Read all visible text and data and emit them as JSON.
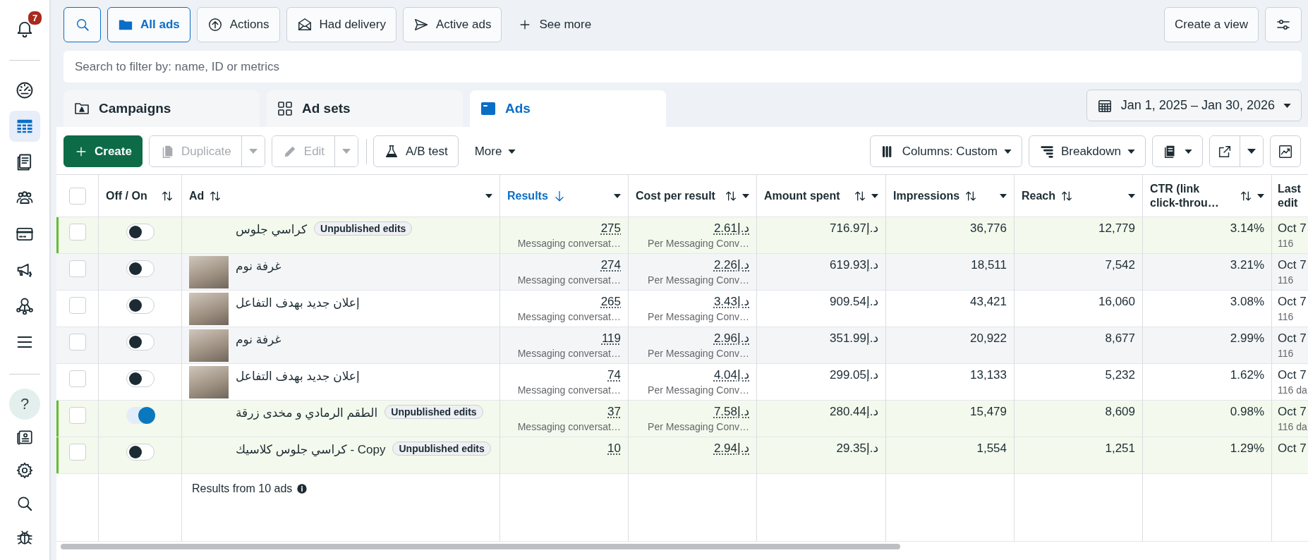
{
  "sidebar": {
    "notification_badge": "7",
    "items": [
      {
        "selected": false
      },
      {
        "selected": true
      },
      {
        "selected": false
      },
      {
        "selected": false
      },
      {
        "selected": false
      },
      {
        "selected": false
      },
      {
        "selected": false
      },
      {
        "selected": false
      }
    ],
    "help": {
      "label": "?"
    },
    "bottom_items": [
      {
        "selected": false
      },
      {
        "selected": false
      },
      {
        "selected": false
      },
      {
        "selected": false
      }
    ]
  },
  "filters": {
    "search_button": {
      "selected": true
    },
    "items": [
      {
        "label": "All ads",
        "selected": true
      },
      {
        "label": "Actions",
        "selected": false
      },
      {
        "label": "Had delivery",
        "selected": false
      },
      {
        "label": "Active ads",
        "selected": false
      }
    ],
    "see_more": "See more",
    "create_view": "Create a view"
  },
  "search": {
    "placeholder": "Search to filter by: name, ID or metrics"
  },
  "level_tabs": [
    {
      "label": "Campaigns",
      "selected": false
    },
    {
      "label": "Ad sets",
      "selected": false
    },
    {
      "label": "Ads",
      "selected": true
    }
  ],
  "date_range": "Jan 1, 2025 – Jan 30, 2026",
  "toolbar": {
    "create": "Create",
    "duplicate": {
      "label": "Duplicate",
      "disabled": true
    },
    "edit": {
      "label": "Edit",
      "disabled": true
    },
    "ab_test": "A/B test",
    "more": "More",
    "columns": "Columns: Custom",
    "breakdown": "Breakdown"
  },
  "table": {
    "select_all_checked": false,
    "columns": [
      {
        "label": "Off / On",
        "sorted": false
      },
      {
        "label": "Ad",
        "sorted": false
      },
      {
        "label": "Results",
        "sorted": true
      },
      {
        "label": "Cost per result",
        "sorted": false
      },
      {
        "label": "Amount spent",
        "sorted": false
      },
      {
        "label": "Impressions",
        "sorted": false
      },
      {
        "label": "Reach",
        "sorted": false
      },
      {
        "label": "CTR (link click-throu…",
        "sorted": false
      },
      {
        "label": "Last edit",
        "sorted": false
      }
    ],
    "rows": [
      {
        "checked": false,
        "on": false,
        "image": false,
        "name": "كراسي جلوس",
        "badge": "Unpublished edits",
        "results": "275",
        "result_type": "Messaging conversat…",
        "cost": "2.61د.إ",
        "cost_type": "Per Messaging Conv…",
        "spent": "716.97د.إ",
        "impressions": "36,776",
        "reach": "12,779",
        "ctr": "3.14%",
        "last_edit": "Oct 7",
        "last_edit_ago": "116"
      },
      {
        "checked": false,
        "on": false,
        "image": true,
        "name": "غرفة نوم",
        "results": "274",
        "result_type": "Messaging conversat…",
        "cost": "2.26د.إ",
        "cost_type": "Per Messaging Conv…",
        "spent": "619.93د.إ",
        "impressions": "18,511",
        "reach": "7,542",
        "ctr": "3.21%",
        "last_edit": "Oct 7",
        "last_edit_ago": "116"
      },
      {
        "checked": false,
        "on": false,
        "image": true,
        "name": "إعلان جديد بهدف التفاعل",
        "results": "265",
        "result_type": "Messaging conversat…",
        "cost": "3.43د.إ",
        "cost_type": "Per Messaging Conv…",
        "spent": "909.54د.إ",
        "impressions": "43,421",
        "reach": "16,060",
        "ctr": "3.08%",
        "last_edit": "Oct 7",
        "last_edit_ago": "116"
      },
      {
        "checked": false,
        "on": false,
        "image": true,
        "name": "غرفة نوم",
        "results": "119",
        "result_type": "Messaging conversat…",
        "cost": "2.96د.إ",
        "cost_type": "Per Messaging Conv…",
        "spent": "351.99د.إ",
        "impressions": "20,922",
        "reach": "8,677",
        "ctr": "2.99%",
        "last_edit": "Oct 7",
        "last_edit_ago": "116"
      },
      {
        "checked": false,
        "on": false,
        "image": true,
        "name": "إعلان جديد بهدف التفاعل",
        "results": "74",
        "result_type": "Messaging conversat…",
        "cost": "4.04د.إ",
        "cost_type": "Per Messaging Conv…",
        "spent": "299.05د.إ",
        "impressions": "13,133",
        "reach": "5,232",
        "ctr": "1.62%",
        "last_edit": "Oct 7",
        "last_edit_ago": "116 da"
      },
      {
        "checked": false,
        "on": true,
        "image": false,
        "name": "الطقم الرمادي و مخدى زرقة",
        "badge": "Unpublished edits",
        "results": "37",
        "result_type": "Messaging conversat…",
        "cost": "7.58د.إ",
        "cost_type": "Per Messaging Conv…",
        "spent": "280.44د.إ",
        "impressions": "15,479",
        "reach": "8,609",
        "ctr": "0.98%",
        "last_edit": "Oct 7",
        "last_edit_ago": "116 da"
      },
      {
        "checked": false,
        "on": false,
        "image": false,
        "name": "كراسي جلوس كلاسيك - Copy",
        "badge": "Unpublished edits",
        "results": "10",
        "cost": "2.94د.إ",
        "spent": "29.35د.إ",
        "impressions": "1,554",
        "reach": "1,251",
        "ctr": "1.29%",
        "last_edit": "Oct 7"
      }
    ],
    "footer": "Results from 10 ads"
  }
}
